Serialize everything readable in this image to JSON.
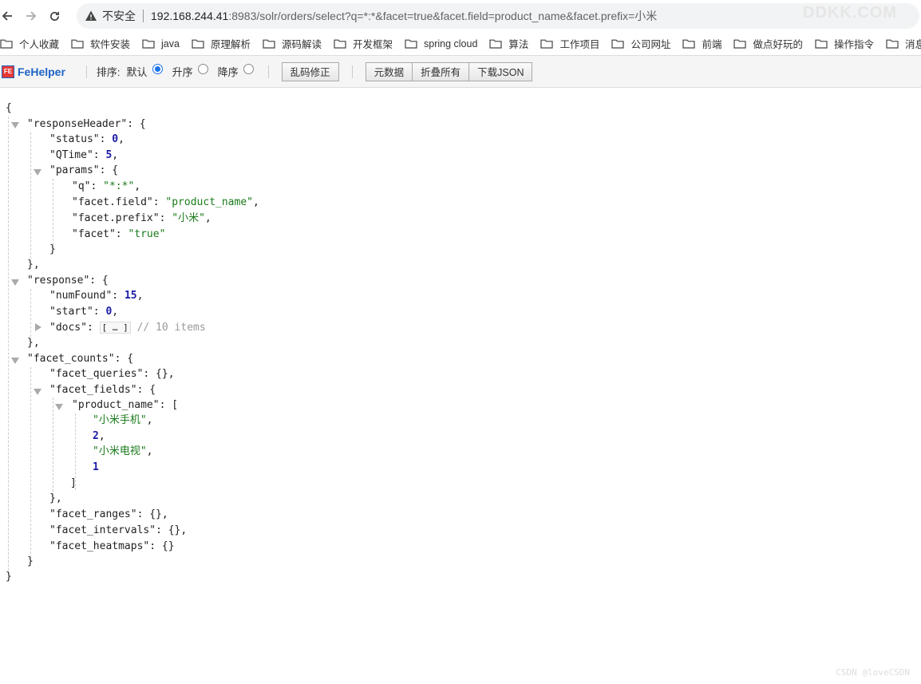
{
  "address": {
    "security_label": "不安全",
    "url_host": "192.168.244.41",
    "url_rest": ":8983/solr/orders/select?q=*:*&facet=true&facet.field=product_name&facet.prefix=小米",
    "watermark": "DDKK.COM"
  },
  "bookmarks": [
    "个人收藏",
    "软件安装",
    "java",
    "原理解析",
    "源码解读",
    "开发框架",
    "spring cloud",
    "算法",
    "工作项目",
    "公司网址",
    "前端",
    "做点好玩的",
    "操作指令",
    "消息"
  ],
  "fehelper": {
    "name": "FeHelper",
    "badge": "FE",
    "sort_label": "排序:",
    "sort_options": [
      "默认",
      "升序",
      "降序"
    ],
    "selected_sort": "默认",
    "fix_button": "乱码修正",
    "buttons": [
      "元数据",
      "折叠所有",
      "下载JSON"
    ]
  },
  "json_tree": {
    "responseHeader": {
      "status": "0",
      "QTime": "5",
      "params": [
        {
          "key": "q",
          "value": "*:*"
        },
        {
          "key": "facet.field",
          "value": "product_name"
        },
        {
          "key": "facet.prefix",
          "value": "小米"
        },
        {
          "key": "facet",
          "value": "true"
        }
      ]
    },
    "response": {
      "numFound": "15",
      "start": "0",
      "docs_summary": "// 10 items"
    },
    "facet_counts": {
      "product_name": [
        "小米手机",
        "2",
        "小米电视",
        "1"
      ]
    }
  },
  "footer_watermark": "CSDN @loveCSDN"
}
